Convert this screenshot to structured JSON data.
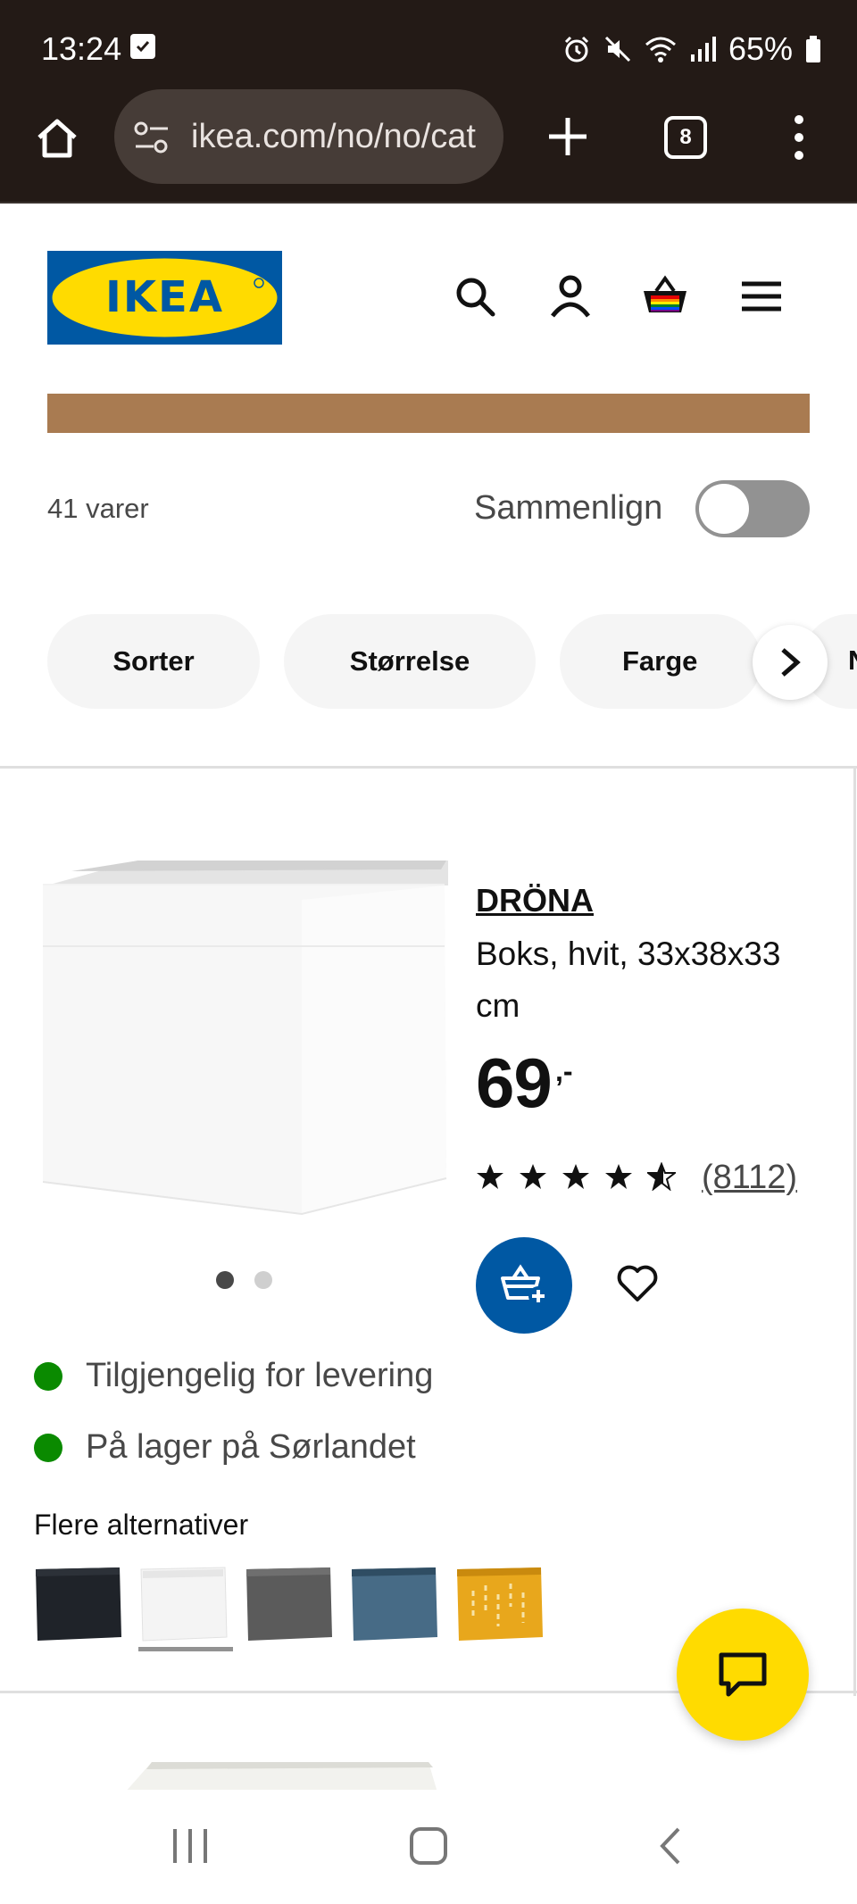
{
  "status_bar": {
    "time": "13:24",
    "battery": "65%",
    "icons": [
      "checkbox-notification-icon",
      "alarm-icon",
      "mute-icon",
      "wifi-icon",
      "signal-icon",
      "battery-icon"
    ]
  },
  "browser": {
    "url": "ikea.com/no/no/cat",
    "tab_count": "8",
    "icons": [
      "home-icon",
      "site-settings-icon",
      "new-tab-icon",
      "tabs-icon",
      "overflow-menu-icon"
    ]
  },
  "header": {
    "logo_text": "IKEA",
    "icons": [
      "search-icon",
      "account-icon",
      "cart-icon",
      "menu-icon"
    ]
  },
  "colors": {
    "browser_bg": "#231a16",
    "ikea_blue": "#0058a3",
    "ikea_yellow": "#ffdb00",
    "promo_band": "#a97b51",
    "availability_green": "#0a8a00"
  },
  "listing": {
    "count_text": "41 varer",
    "compare_label": "Sammenlign",
    "compare_enabled": false
  },
  "filters": [
    {
      "label": "Sorter"
    },
    {
      "label": "Størrelse"
    },
    {
      "label": "Farge"
    }
  ],
  "product": {
    "name": "DRÖNA",
    "description": "Boks, hvit, 33x38x33 cm",
    "price": "69",
    "price_suffix": ",-",
    "rating_stars": 4.5,
    "rating_count": "(8112)",
    "image_count": 2,
    "active_image": 1,
    "availability": [
      {
        "text": "Tilgjengelig for levering"
      },
      {
        "text": "På lager på Sørlandet"
      }
    ],
    "more_options_label": "Flere alternativer",
    "swatches": [
      {
        "name": "black",
        "color": "#1f2329"
      },
      {
        "name": "white",
        "color": "#f4f4f4",
        "selected": true
      },
      {
        "name": "dark-grey",
        "color": "#5b5b5b"
      },
      {
        "name": "blue",
        "color": "#476b86"
      },
      {
        "name": "yellow-pattern",
        "color": "#e8a71c"
      }
    ]
  }
}
